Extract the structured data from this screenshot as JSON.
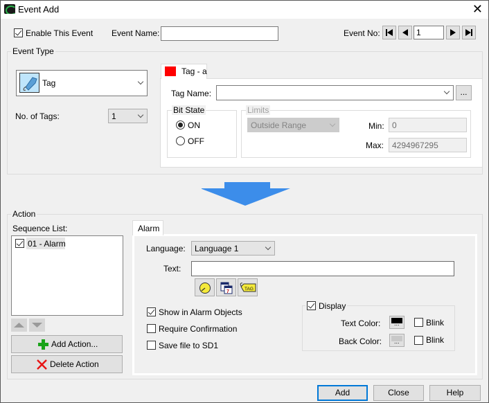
{
  "window": {
    "title": "Event Add",
    "close_icon": "close-icon"
  },
  "header": {
    "enable_label": "Enable This Event",
    "enable_checked": true,
    "event_name_label": "Event Name:",
    "event_name_value": "",
    "event_no_label": "Event No:",
    "event_no_value": "1",
    "nav_icons": [
      "first-icon",
      "prev-icon",
      "next-icon",
      "last-icon"
    ]
  },
  "event_type": {
    "group_label": "Event Type",
    "type_value": "Tag",
    "type_icon": "tag-icon",
    "num_tags_label": "No. of Tags:",
    "num_tags_value": "1",
    "tab": {
      "label": "Tag - a",
      "color": "#ff0000",
      "tag_name_label": "Tag Name:",
      "tag_name_value": "",
      "browse_label": "...",
      "bit_state": {
        "label": "Bit State",
        "options": [
          "ON",
          "OFF"
        ],
        "selected": "ON"
      },
      "limits": {
        "label": "Limits",
        "mode_value": "Outside Range",
        "min_label": "Min:",
        "min_value": "0",
        "max_label": "Max:",
        "max_value": "4294967295"
      }
    }
  },
  "arrow": {
    "color": "#3c8dea"
  },
  "action": {
    "group_label": "Action",
    "sequence_label": "Sequence List:",
    "sequence_items": [
      {
        "label": "01 - Alarm",
        "checked": true
      }
    ],
    "add_action_label": "Add Action...",
    "delete_action_label": "Delete Action",
    "tab": {
      "label": "Alarm",
      "language_label": "Language:",
      "language_value": "Language 1",
      "text_label": "Text:",
      "text_value": "",
      "insert_icons": [
        "clock-icon",
        "calendar-icon",
        "tag-insert-icon"
      ],
      "options": [
        {
          "label": "Show in Alarm Objects",
          "checked": true
        },
        {
          "label": "Require Confirmation",
          "checked": false
        },
        {
          "label": "Save file to SD1",
          "checked": false
        }
      ],
      "display": {
        "label": "Display",
        "checked": true,
        "text_color_label": "Text Color:",
        "text_color": "#000000",
        "text_blink_label": "Blink",
        "text_blink": false,
        "back_color_label": "Back Color:",
        "back_color": "#c8c8c8",
        "back_blink_label": "Blink",
        "back_blink": false,
        "swatch_dots": "..."
      }
    }
  },
  "footer": {
    "add_label": "Add",
    "close_label": "Close",
    "help_label": "Help"
  }
}
